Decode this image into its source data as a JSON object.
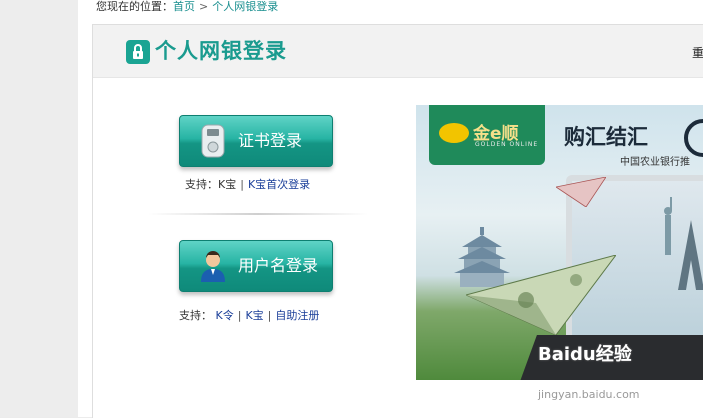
{
  "breadcrumb": {
    "prefix": "您现在的位置：",
    "home": "首页",
    "separator": ">",
    "current": "个人网银登录"
  },
  "panel": {
    "title": "个人网银登录",
    "head_right_text": "重"
  },
  "cert_login": {
    "label": "证书登录",
    "icon": "usb-key-icon",
    "support_prefix": "支持：K宝",
    "support_sep": "|",
    "support_link": "K宝首次登录"
  },
  "user_login": {
    "label": "用户名登录",
    "icon": "user-avatar-icon",
    "support_prefix": "支持：",
    "links": [
      "K令",
      "K宝",
      "自助注册"
    ],
    "sep": "|"
  },
  "banner": {
    "logo_text": "金e顺",
    "logo_sub": "GOLDEN ONLINE",
    "headline": "购汇结汇",
    "subline": "中国农业银行推"
  },
  "watermark": {
    "main": "Baidu经验",
    "sub": "jingyan.baidu.com"
  },
  "colors": {
    "accent": "#1a9b8f",
    "button_top": "#5fd3c6",
    "button_bottom": "#0f8a7a",
    "link": "#1a3e99"
  }
}
